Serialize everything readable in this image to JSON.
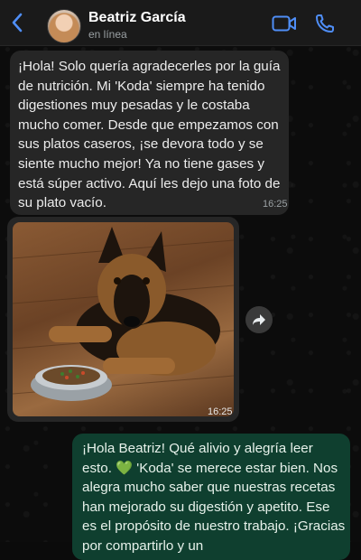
{
  "contact": {
    "name": "Beatriz García",
    "status": "en línea"
  },
  "messages": [
    {
      "direction": "incoming",
      "text": "¡Hola! Solo quería agradecerles por la guía de nutrición. Mi 'Koda' siempre ha tenido digestiones muy pesadas y le costaba mucho comer. Desde que empezamos con sus platos caseros, ¡se devora todo y se siente mucho mejor! Ya no tiene gases y está súper activo. Aquí les dejo una foto de su plato vacío.",
      "time": "16:25"
    },
    {
      "direction": "incoming",
      "type": "photo",
      "photo_description": "German Shepherd lying on wooden floor next to a food bowl",
      "time": "16:25"
    },
    {
      "direction": "outgoing",
      "text_before_emoji": "¡Hola Beatriz! Qué alivio y alegría leer esto. ",
      "emoji": "💚",
      "text_after_emoji": " 'Koda' se merece estar bien. Nos alegra mucho saber que nuestras recetas han mejorado su digestión y apetito. Ese es el propósito de nuestro trabajo. ¡Gracias por compartirlo y un"
    }
  ],
  "icons": {
    "back": "chevron-left-icon",
    "video": "video-camera-icon",
    "call": "phone-icon",
    "forward": "forward-arrow-icon"
  },
  "colors": {
    "accent": "#4f8ef7",
    "incoming_bubble": "#262626",
    "outgoing_bubble": "#0f3f2f"
  }
}
